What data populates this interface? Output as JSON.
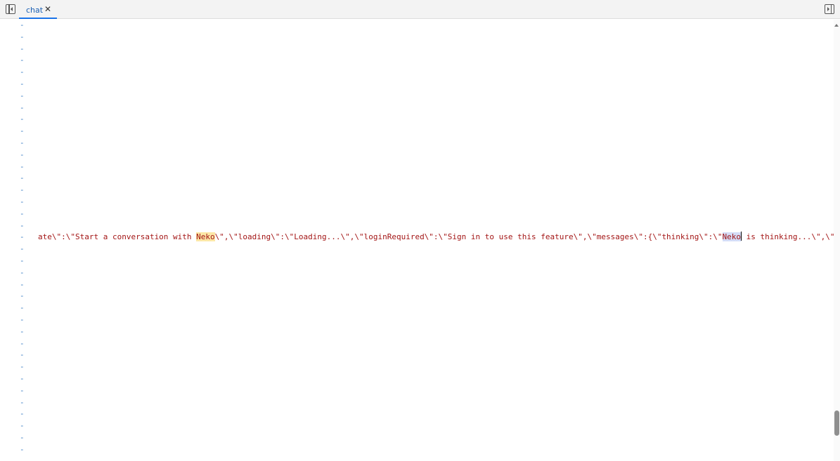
{
  "tabs": [
    {
      "label": "chat",
      "close_glyph": "✕",
      "active": true
    }
  ],
  "icons": {
    "left_toggle": "sidebar-left-toggle-icon",
    "right_toggle": "sidebar-right-toggle-icon"
  },
  "gutter": {
    "marker": "-",
    "count": 37
  },
  "code": {
    "before_match": "ate\\\":\\\"Start a conversation with ",
    "match_1": "Neko",
    "middle": "\\\",\\\"loading\\\":\\\"Loading...\\\",\\\"loginRequired\\\":\\\"Sign in to use this feature\\\",\\\"messages\\\":{\\\"thinking\\\":\\\"",
    "match_2": "Neko",
    "after_match": " is thinking...\\\",\\\"r"
  },
  "colors": {
    "string_text": "#a31515",
    "find_highlight": "#fce7a6",
    "selection_highlight": "#d4dcf6",
    "gutter_marker": "#3d7fc4",
    "tab_accent": "#1a73e8"
  }
}
